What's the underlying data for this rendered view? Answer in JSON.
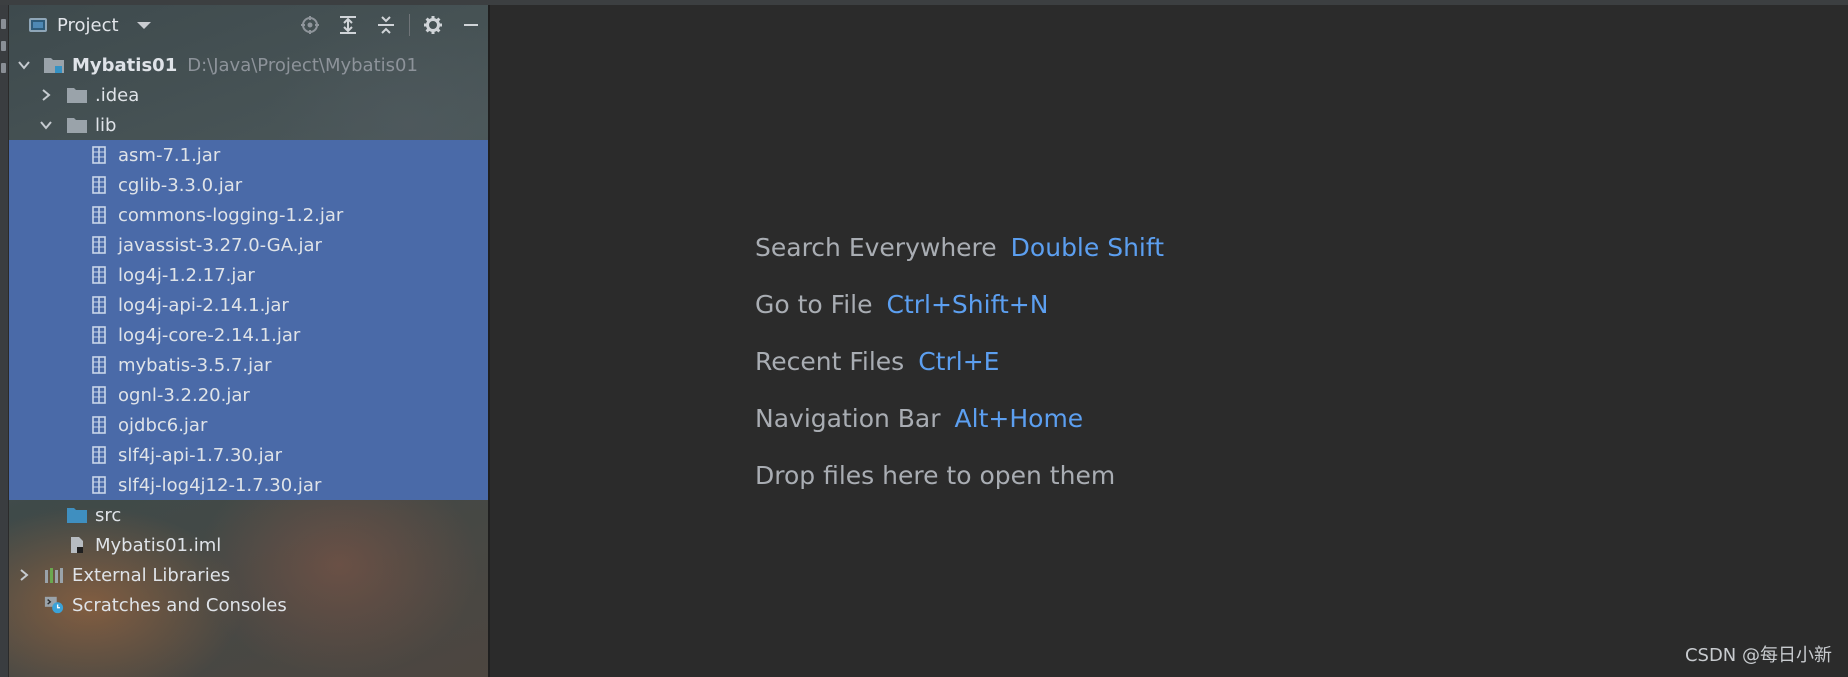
{
  "panel": {
    "title": "Project",
    "actions": [
      "locate-icon",
      "expand-all-icon",
      "collapse-all-icon",
      "gear-icon",
      "minimize-icon"
    ]
  },
  "tree": {
    "root": {
      "name": "Mybatis01",
      "path": "D:\\Java\\Project\\Mybatis01"
    },
    "idea": ".idea",
    "lib": "lib",
    "jars": [
      "asm-7.1.jar",
      "cglib-3.3.0.jar",
      "commons-logging-1.2.jar",
      "javassist-3.27.0-GA.jar",
      "log4j-1.2.17.jar",
      "log4j-api-2.14.1.jar",
      "log4j-core-2.14.1.jar",
      "mybatis-3.5.7.jar",
      "ognl-3.2.20.jar",
      "ojdbc6.jar",
      "slf4j-api-1.7.30.jar",
      "slf4j-log4j12-1.7.30.jar"
    ],
    "src": "src",
    "iml": "Mybatis01.iml",
    "external": "External Libraries",
    "scratches": "Scratches and Consoles"
  },
  "editor": {
    "hints": [
      {
        "label": "Search Everywhere",
        "key": "Double Shift"
      },
      {
        "label": "Go to File",
        "key": "Ctrl+Shift+N"
      },
      {
        "label": "Recent Files",
        "key": "Ctrl+E"
      },
      {
        "label": "Navigation Bar",
        "key": "Alt+Home"
      }
    ],
    "drop_text": "Drop files here to open them"
  },
  "watermark": "CSDN @每日小新",
  "colors": {
    "selection": "#4a6aa8",
    "shortcut": "#5c9ff0",
    "editor_bg": "#2b2b2b"
  }
}
